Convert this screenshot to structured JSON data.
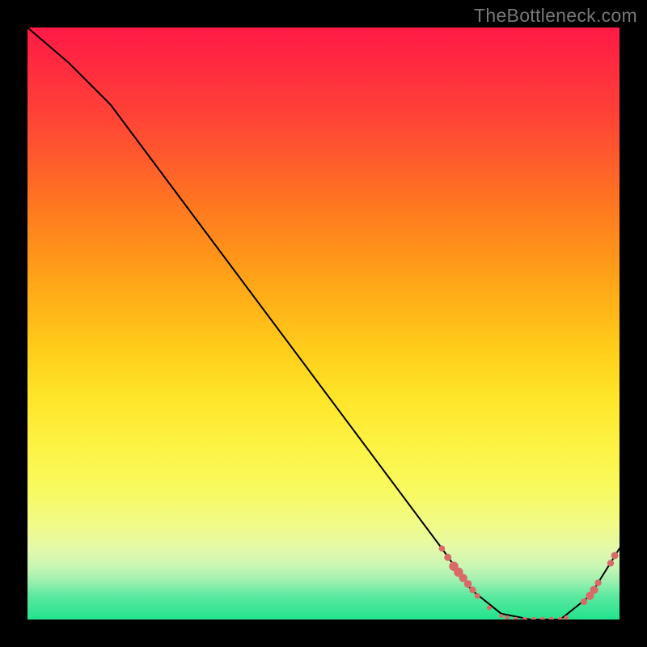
{
  "watermark": "TheBottleneck.com",
  "chart_data": {
    "type": "line",
    "title": "",
    "xlabel": "",
    "ylabel": "",
    "xlim": [
      0,
      100
    ],
    "ylim": [
      0,
      100
    ],
    "grid": false,
    "legend": false,
    "series": [
      {
        "name": "curve",
        "x": [
          0,
          7,
          14,
          70,
          75,
          80,
          85,
          90,
          95,
          100
        ],
        "y": [
          100,
          94,
          87,
          12,
          5,
          1,
          0,
          0,
          4,
          12
        ]
      }
    ],
    "markers": {
      "color": "#d86b68",
      "points": [
        {
          "x": 70,
          "y": 12,
          "r": 2.4
        },
        {
          "x": 71,
          "y": 10.5,
          "r": 2.8
        },
        {
          "x": 72,
          "y": 9,
          "r": 3.6
        },
        {
          "x": 72.8,
          "y": 8,
          "r": 3.6
        },
        {
          "x": 73.6,
          "y": 7,
          "r": 3.2
        },
        {
          "x": 74.4,
          "y": 6,
          "r": 3.0
        },
        {
          "x": 75.2,
          "y": 5,
          "r": 2.6
        },
        {
          "x": 76,
          "y": 4,
          "r": 2.2
        },
        {
          "x": 78,
          "y": 2,
          "r": 1.8
        },
        {
          "x": 80,
          "y": 0.6,
          "r": 1.6
        },
        {
          "x": 81,
          "y": 0.3,
          "r": 1.8
        },
        {
          "x": 82.5,
          "y": 0,
          "r": 2.0
        },
        {
          "x": 84,
          "y": 0,
          "r": 2.0
        },
        {
          "x": 85.5,
          "y": 0,
          "r": 2.0
        },
        {
          "x": 87,
          "y": 0,
          "r": 2.0
        },
        {
          "x": 88.5,
          "y": 0,
          "r": 2.0
        },
        {
          "x": 90,
          "y": 0,
          "r": 2.0
        },
        {
          "x": 91,
          "y": 0.3,
          "r": 1.8
        },
        {
          "x": 94,
          "y": 3,
          "r": 2.6
        },
        {
          "x": 95,
          "y": 4,
          "r": 3.2
        },
        {
          "x": 95.7,
          "y": 5,
          "r": 3.2
        },
        {
          "x": 96.4,
          "y": 6.2,
          "r": 2.6
        },
        {
          "x": 98.5,
          "y": 9.5,
          "r": 2.6
        },
        {
          "x": 99.2,
          "y": 10.8,
          "r": 2.8
        }
      ]
    }
  }
}
